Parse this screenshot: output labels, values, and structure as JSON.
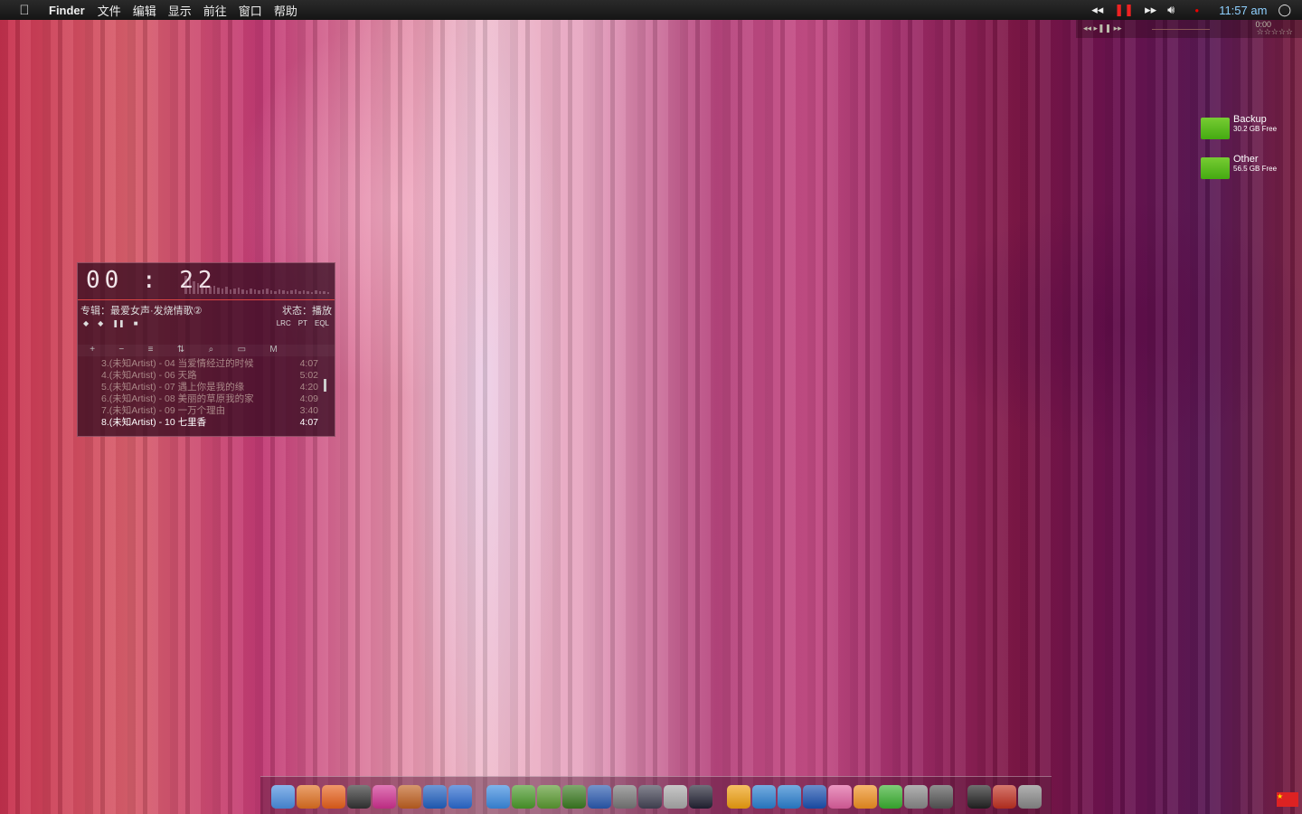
{
  "menubar": {
    "app": "Finder",
    "items": [
      "文件",
      "编辑",
      "显示",
      "前往",
      "窗口",
      "帮助"
    ],
    "clock": "11:57 am"
  },
  "media_bar": {
    "time": "0:00",
    "rating": "☆☆☆☆☆"
  },
  "player": {
    "time": "00 : 22",
    "album": "专辑：最爱女声·发烧情歌②",
    "status": "状态：播放",
    "buttons": [
      "LRC",
      "PT",
      "EQL"
    ],
    "tracks": [
      {
        "title": "3.(未知Artist) - 04 当爱情经过的时候",
        "duration": "4:07"
      },
      {
        "title": "4.(未知Artist) - 06 天路",
        "duration": "5:02"
      },
      {
        "title": "5.(未知Artist) - 07 遇上你是我的缘",
        "duration": "4:20"
      },
      {
        "title": "6.(未知Artist) - 08 美丽的草原我的家",
        "duration": "4:09"
      },
      {
        "title": "7.(未知Artist) - 09 一万个理由",
        "duration": "3:40"
      },
      {
        "title": "8.(未知Artist) - 10 七里香",
        "duration": "4:07",
        "current": true
      }
    ]
  },
  "desktop": [
    {
      "name": "Backup",
      "free": "30.2 GB Free"
    },
    {
      "name": "Other",
      "free": "56.5 GB Free"
    }
  ],
  "dock": [
    [
      "finder",
      "#4a8ee0"
    ],
    [
      "archive",
      "#e07020"
    ],
    [
      "firefox",
      "#e8601a"
    ],
    [
      "tuxedo",
      "#333"
    ],
    [
      "itunes",
      "#d03090"
    ],
    [
      "iphoto",
      "#c06020"
    ],
    [
      "tasks",
      "#2060c0"
    ],
    [
      "info",
      "#2a6ad0"
    ],
    [
      "globe",
      "#3a8ae0"
    ],
    [
      "leaf",
      "#4a9a2a"
    ],
    [
      "camera-green",
      "#5a9a30"
    ],
    [
      "plant",
      "#3a7a20"
    ],
    [
      "chart",
      "#2a5ab0"
    ],
    [
      "screenshot",
      "#777"
    ],
    [
      "hammer",
      "#445"
    ],
    [
      "remote",
      "#aaa"
    ],
    [
      "quicktime",
      "#223"
    ],
    [
      "firewire",
      "#f0a010"
    ],
    [
      "wifi",
      "#2a80d0"
    ],
    [
      "usb",
      "#2a80d0"
    ],
    [
      "sketch-blue",
      "#1a50b0"
    ],
    [
      "pen-pink",
      "#e060a0"
    ],
    [
      "pencil-orange",
      "#f09020"
    ],
    [
      "download",
      "#3ab030"
    ],
    [
      "calculator",
      "#888"
    ],
    [
      "system-prefs",
      "#555"
    ],
    [
      "clock",
      "#222"
    ],
    [
      "calendar",
      "#c03020"
    ],
    [
      "drive",
      "#888"
    ]
  ]
}
